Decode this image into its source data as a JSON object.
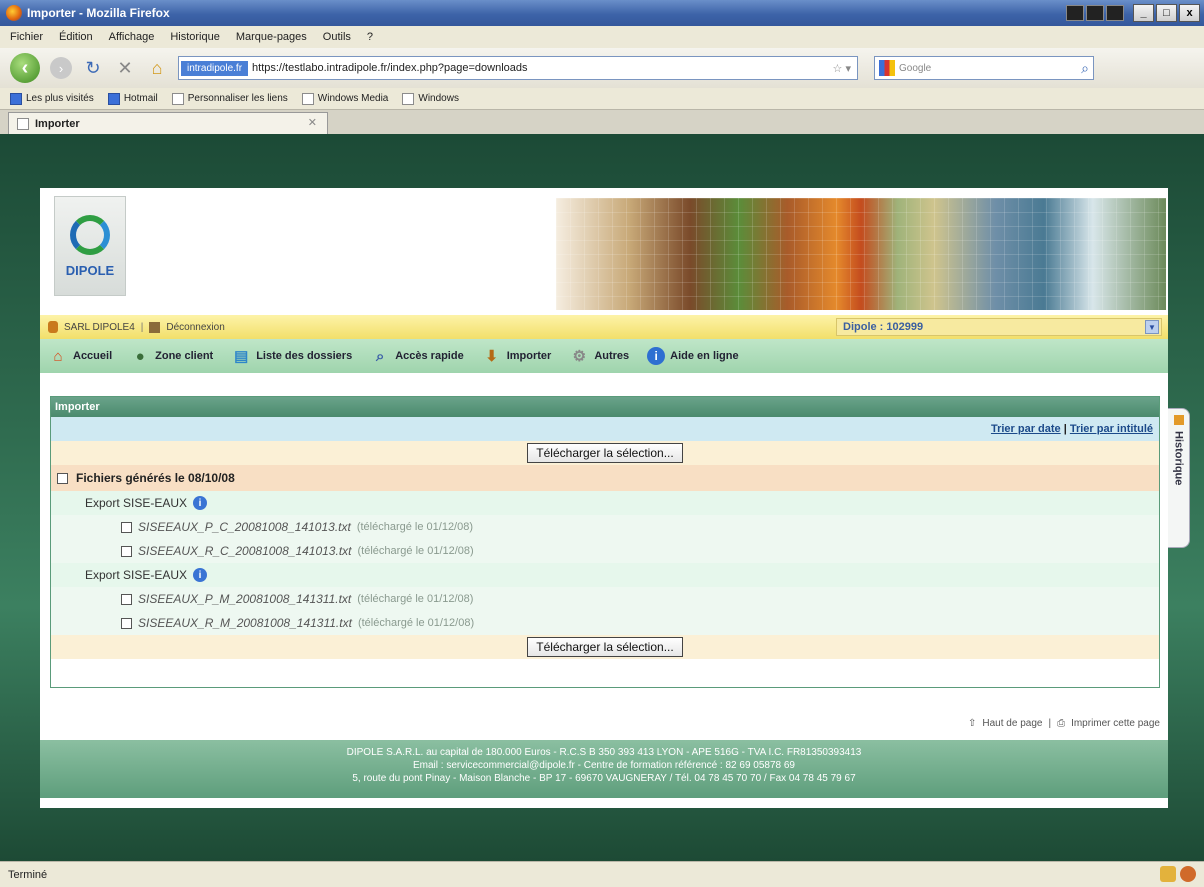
{
  "window": {
    "title": "Importer - Mozilla Firefox",
    "controls": [
      "_",
      "□",
      "x"
    ]
  },
  "menu": [
    "Fichier",
    "Édition",
    "Affichage",
    "Historique",
    "Marque-pages",
    "Outils",
    "?"
  ],
  "navbar": {
    "site_badge": "intradipole.fr",
    "url": "https://testlabo.intradipole.fr/index.php?page=downloads",
    "search_placeholder": "Google"
  },
  "bookmarks": [
    "Les plus visités",
    "Hotmail",
    "Personnaliser les liens",
    "Windows Media",
    "Windows"
  ],
  "tab": {
    "label": "Importer"
  },
  "site": {
    "logo_text": "DIPOLE",
    "user": "SARL DIPOLE4",
    "logout": "Déconnexion",
    "dossier": "Dipole : 102999",
    "nav": [
      {
        "label": "Accueil",
        "icon": "home-icon"
      },
      {
        "label": "Zone client",
        "icon": "user-icon"
      },
      {
        "label": "Liste des dossiers",
        "icon": "folder-list-icon"
      },
      {
        "label": "Accès rapide",
        "icon": "search-icon"
      },
      {
        "label": "Importer",
        "icon": "import-icon"
      },
      {
        "label": "Autres",
        "icon": "tools-icon"
      },
      {
        "label": "Aide en ligne",
        "icon": "help-icon"
      }
    ],
    "panel": {
      "title": "Importer",
      "sort_date": "Trier par date",
      "sort_separator": "|",
      "sort_title": "Trier par intitulé",
      "download_button": "Télécharger la sélection...",
      "group_label": "Fichiers générés le 08/10/08",
      "exports": [
        {
          "label": "Export SISE-EAUX",
          "files": [
            {
              "name": "SISEEAUX_P_C_20081008_141013.txt",
              "note": "(téléchargé le 01/12/08)"
            },
            {
              "name": "SISEEAUX_R_C_20081008_141013.txt",
              "note": "(téléchargé le 01/12/08)"
            }
          ]
        },
        {
          "label": "Export SISE-EAUX",
          "files": [
            {
              "name": "SISEEAUX_P_M_20081008_141311.txt",
              "note": "(téléchargé le 01/12/08)"
            },
            {
              "name": "SISEEAUX_R_M_20081008_141311.txt",
              "note": "(téléchargé le 01/12/08)"
            }
          ]
        }
      ]
    },
    "page_links": {
      "top": "Haut de page",
      "separator": "|",
      "print": "Imprimer cette page"
    },
    "footer": [
      "DIPOLE S.A.R.L. au capital de 180.000 Euros - R.C.S B 350 393 413 LYON - APE 516G - TVA I.C. FR81350393413",
      "Email : servicecommercial@dipole.fr - Centre de formation référencé : 82 69 05878 69",
      "5, route du pont Pinay - Maison Blanche - BP 17 - 69670 VAUGNERAY / Tél. 04 78 45 70 70 / Fax 04 78 45 79 67"
    ],
    "side_tab": "Historique"
  },
  "status": {
    "text": "Terminé"
  }
}
